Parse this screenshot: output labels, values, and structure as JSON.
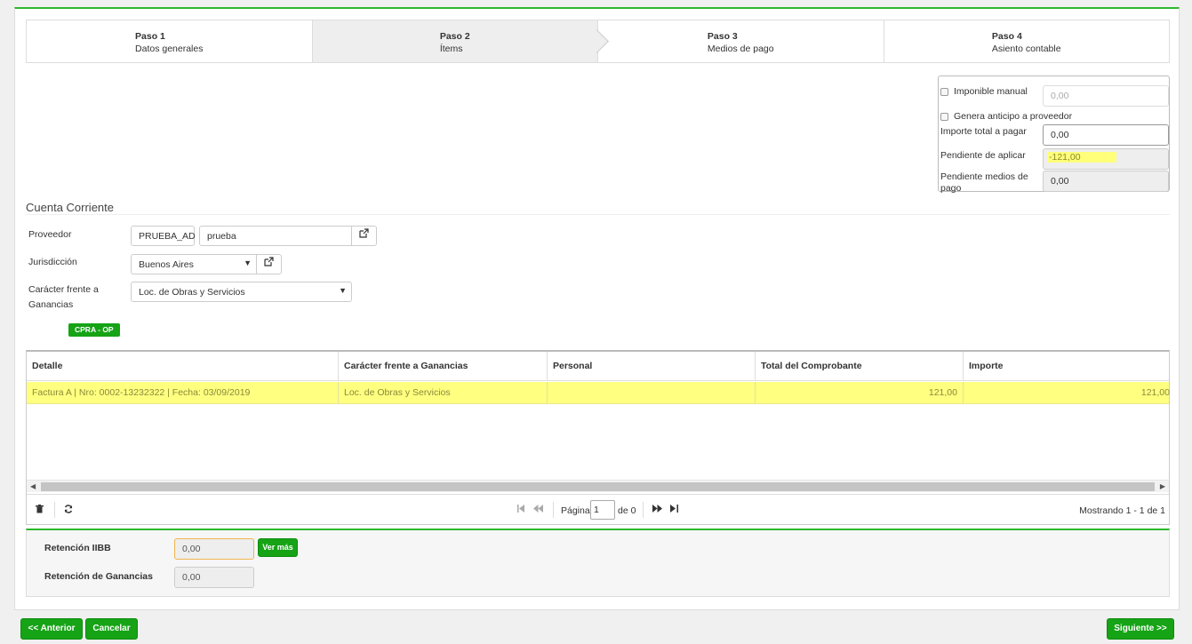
{
  "wizard": {
    "steps": [
      {
        "num": "Paso 1",
        "name": "Datos generales"
      },
      {
        "num": "Paso 2",
        "name": "Ítems"
      },
      {
        "num": "Paso 3",
        "name": "Medios de pago"
      },
      {
        "num": "Paso 4",
        "name": "Asiento contable"
      }
    ],
    "active_index": 1
  },
  "summary": {
    "imponible_manual_label": "Imponible manual",
    "imponible_manual_value": "0,00",
    "genera_anticipo_label": "Genera anticipo a proveedor",
    "importe_total_label": "Importe total a pagar",
    "importe_total_value": "0,00",
    "pendiente_aplicar_label": "Pendiente de aplicar",
    "pendiente_aplicar_value": "-121,00",
    "pendiente_medios_label_1": "Pendiente medios de",
    "pendiente_medios_label_2": "pago",
    "pendiente_medios_value": "0,00"
  },
  "cuenta_corriente": {
    "title": "Cuenta Corriente",
    "proveedor_label": "Proveedor",
    "proveedor_code": "PRUEBA_AD",
    "proveedor_name": "prueba",
    "jurisdiccion_label": "Jurisdicción",
    "jurisdiccion_value": "Buenos Aires",
    "caracter_label_1": "Carácter frente a",
    "caracter_label_2": "Ganancias",
    "caracter_value": "Loc. de Obras y Servicios",
    "tag": "CPRA - OP"
  },
  "grid": {
    "columns": [
      "Detalle",
      "Carácter frente a Ganancias",
      "Personal",
      "Total del Comprobante",
      "Importe"
    ],
    "rows": [
      {
        "detalle": "Factura A | Nro: 0002-13232322 | Fecha: 03/09/2019",
        "caracter": "Loc. de Obras y Servicios",
        "personal": "",
        "total": "121,00",
        "importe": "121,00"
      }
    ],
    "pager": {
      "page_label": "Página",
      "page_value": "1",
      "of_label": "de 0",
      "showing": "Mostrando 1 - 1 de 1"
    }
  },
  "retention": {
    "iibb_label": "Retención IIBB",
    "iibb_value": "0,00",
    "ver_mas": "Ver más",
    "ganancias_label": "Retención de Ganancias",
    "ganancias_value": "0,00"
  },
  "footer": {
    "prev": "<< Anterior",
    "cancel": "Cancelar",
    "next": "Siguiente >>"
  },
  "colors": {
    "accent": "#2db82d",
    "button_green": "#16a316",
    "highlight": "#ffff80"
  },
  "icons": {
    "external_link": "external-link-icon",
    "trash": "trash-icon",
    "refresh": "refresh-icon",
    "first": "first-page-icon",
    "prev": "prev-page-icon",
    "next": "next-page-icon",
    "last": "last-page-icon"
  }
}
